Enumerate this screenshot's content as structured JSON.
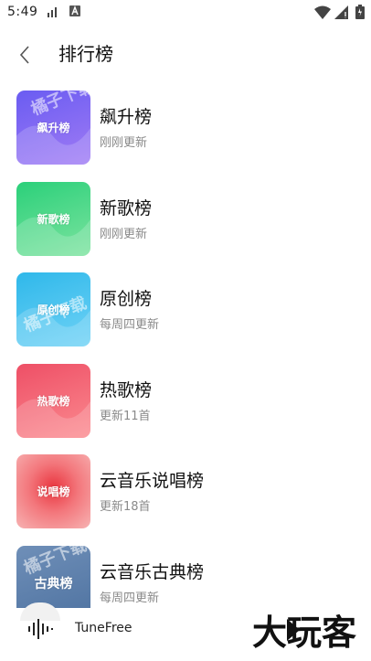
{
  "status": {
    "time": "5:49"
  },
  "header": {
    "title": "排行榜"
  },
  "charts": [
    {
      "cover_label": "飙升榜",
      "name": "飙升榜",
      "sub": "刚刚更新",
      "c1": "#6a5cf2",
      "c2": "#a07bf4"
    },
    {
      "cover_label": "新歌榜",
      "name": "新歌榜",
      "sub": "刚刚更新",
      "c1": "#2bd07a",
      "c2": "#7ce39f"
    },
    {
      "cover_label": "原创榜",
      "name": "原创榜",
      "sub": "每周四更新",
      "c1": "#2fb8ea",
      "c2": "#6fd2f6"
    },
    {
      "cover_label": "热歌榜",
      "name": "热歌榜",
      "sub": "更新11首",
      "c1": "#ee4f66",
      "c2": "#fb8a8f"
    },
    {
      "cover_label": "说唱榜",
      "name": "云音乐说唱榜",
      "sub": "更新18首",
      "c1": "#f08a8a",
      "c2": "#e9353f"
    },
    {
      "cover_label": "古典榜",
      "name": "云音乐古典榜",
      "sub": "每周四更新",
      "c1": "#6f8fb8",
      "c2": "#4f73a1"
    }
  ],
  "player": {
    "title": "TuneFree"
  },
  "watermark": {
    "text": "橘子下载"
  },
  "logo": {
    "text": "大玩客"
  },
  "icons": {
    "back": "chevron-left-icon",
    "wifi": "wifi-icon",
    "cell": "cellular-icon",
    "battery": "battery-icon",
    "wave": "audio-wave-icon"
  }
}
